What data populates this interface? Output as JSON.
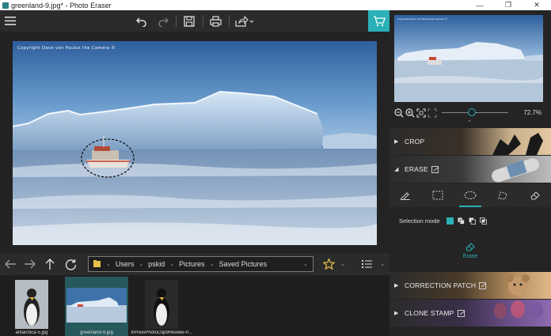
{
  "window": {
    "title": "greenland-9.jpg* - Photo Eraser",
    "controls": {
      "minimize": "—",
      "maximize": "❐",
      "close": "✕"
    }
  },
  "toolbar": {
    "icons": [
      "menu-icon",
      "undo-icon",
      "redo-icon",
      "save-icon",
      "print-icon",
      "share-icon",
      "cart-icon"
    ]
  },
  "image": {
    "copyright": "Copyright Dave von Paulus the Camera ©"
  },
  "navigation": {
    "path": [
      "Users",
      "pskid",
      "Pictures",
      "Saved Pictures"
    ]
  },
  "thumbnails": [
    {
      "caption": "antarctica-5.jpg",
      "selected": false
    },
    {
      "caption": "greenland-9.jpg",
      "selected": true
    },
    {
      "caption": "InPixioPhotoClip9Review-P...",
      "selected": false
    }
  ],
  "preview": {
    "zoom": "72.7%",
    "zoom_fraction": 0.45
  },
  "panel": {
    "crop": "CROP",
    "erase": "ERASE",
    "selection_mode_label": "Selection mode",
    "erase_button": "Erase",
    "correction_patch": "CORRECTION PATCH",
    "clone_stamp": "CLONE STAMP"
  },
  "colors": {
    "accent": "#2ab1b7",
    "selected_thumb": "#26595c"
  }
}
